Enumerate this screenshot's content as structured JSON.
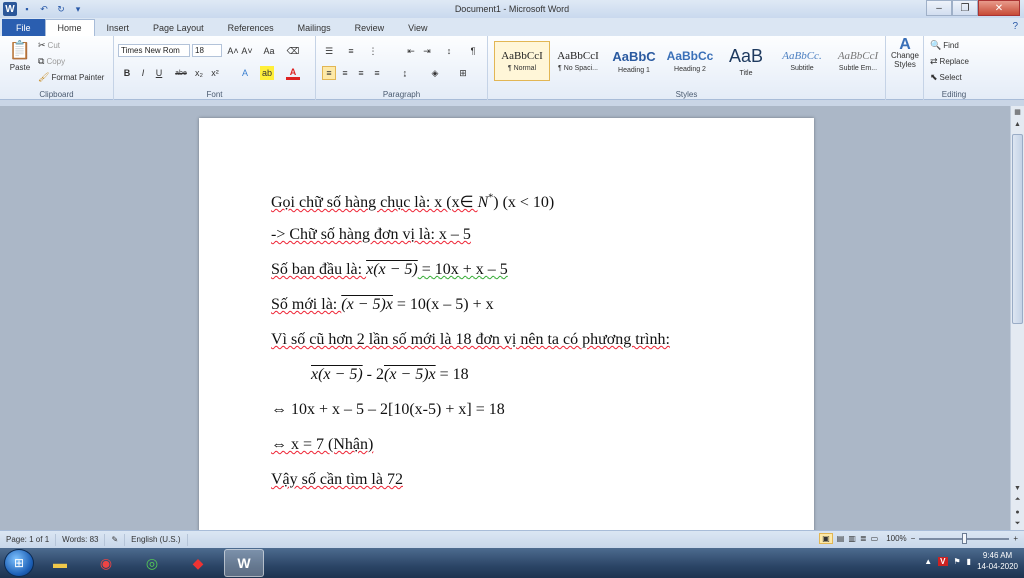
{
  "window": {
    "title": "Document1 - Microsoft Word",
    "minimize": "–",
    "maximize": "❐",
    "close": "✕"
  },
  "tabs": [
    {
      "label": "File"
    },
    {
      "label": "Home"
    },
    {
      "label": "Insert"
    },
    {
      "label": "Page Layout"
    },
    {
      "label": "References"
    },
    {
      "label": "Mailings"
    },
    {
      "label": "Review"
    },
    {
      "label": "View"
    }
  ],
  "ribbon": {
    "clipboard": {
      "label": "Clipboard",
      "paste": "Paste",
      "cut": "Cut",
      "copy": "Copy",
      "format_painter": "Format Painter"
    },
    "font": {
      "label": "Font",
      "font_name": "Times New Rom",
      "font_size": "18",
      "bold": "B",
      "italic": "I",
      "underline": "U",
      "strike": "abe",
      "subscript": "x₂",
      "superscript": "x²",
      "grow": "A˄",
      "shrink": "A˅",
      "change_case": "Aa",
      "highlight": "ab",
      "font_color": "A"
    },
    "paragraph": {
      "label": "Paragraph",
      "pilcrow": "¶"
    },
    "styles": {
      "label": "Styles",
      "items": [
        {
          "sample": "AaBbCcI",
          "name": "¶ Normal"
        },
        {
          "sample": "AaBbCcI",
          "name": "¶ No Spaci..."
        },
        {
          "sample": "AaBbC",
          "name": "Heading 1"
        },
        {
          "sample": "AaBbCc",
          "name": "Heading 2"
        },
        {
          "sample": "AaB",
          "name": "Title"
        },
        {
          "sample": "AaBbCc.",
          "name": "Subtitle"
        },
        {
          "sample": "AaBbCcI",
          "name": "Subtle Em..."
        }
      ],
      "change_styles": "Change Styles"
    },
    "editing": {
      "label": "Editing",
      "find": "Find",
      "replace": "Replace",
      "select": "Select"
    }
  },
  "document": {
    "lines": [
      {
        "a": " Gọi chữ số hàng chục là: x (x∈ ",
        "b": "N",
        "c": "*",
        "d": ") (x < 10)"
      },
      {
        "a": "-> Chữ số hàng đơn vị là: x – 5"
      },
      {
        "a": "Số ban đầu là: ",
        "b": "x(x − 5)",
        "c": " = 10x + x – 5"
      },
      {
        "a": "Số mới là: ",
        "b": "(x − 5)x",
        "c": " = 10(x – 5) + x"
      },
      {
        "a": "Vì số cũ hơn 2 lần số mới là 18 đơn vị nên ta có phương trình:"
      },
      {
        "a": "x(x − 5)",
        "b": " - 2",
        "c": "(x − 5)x",
        "d": " = 18"
      },
      {
        "a": "⇔ 10x + x – 5 – 2[10(x-5) + x] = 18"
      },
      {
        "a": "⇔ x = 7 (Nhận)"
      },
      {
        "a": "Vậy số cần tìm là 72"
      }
    ]
  },
  "status": {
    "page": "Page: 1 of 1",
    "words": "Words: 83",
    "language": "English (U.S.)",
    "zoom": "100%",
    "zoom_minus": "−",
    "zoom_plus": "+"
  },
  "taskbar": {
    "time": "9:46 AM",
    "date": "14-04-2020"
  },
  "colors": {
    "file_tab": "#2a5eb0",
    "ribbon_bg": "#e4ecf7",
    "doc_bg": "#abb7c7",
    "taskbar": "#2b4566"
  }
}
